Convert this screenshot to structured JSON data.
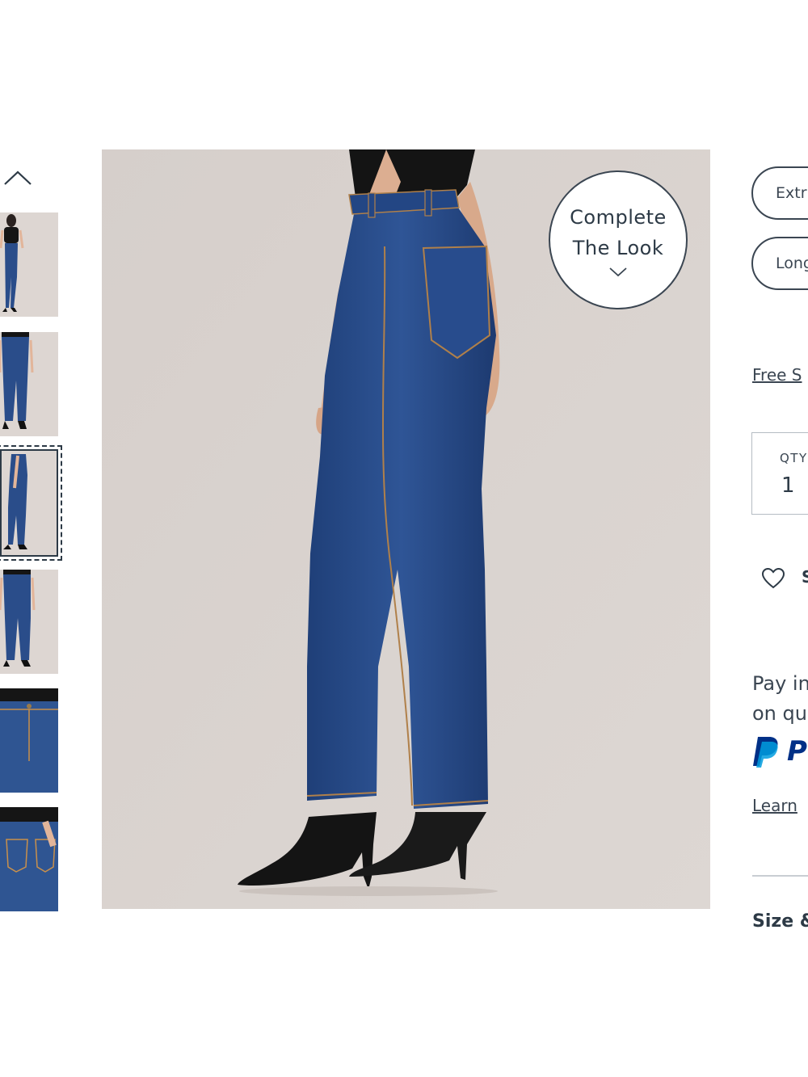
{
  "gallery": {
    "thumbnails": [
      {
        "label": "front view"
      },
      {
        "label": "front close view"
      },
      {
        "label": "side view",
        "active": true
      },
      {
        "label": "back view"
      },
      {
        "label": "front waist detail"
      },
      {
        "label": "back pocket detail"
      }
    ],
    "complete_look": {
      "line1": "Complete",
      "line2": "The Look"
    }
  },
  "product_panel": {
    "length_options": [
      "Extr",
      "Long"
    ],
    "shipping_link": "Free S",
    "quantity": {
      "label": "QTY",
      "value": "1"
    },
    "save_label": "S",
    "payment": {
      "line1": "Pay in",
      "line2": "on qu",
      "paypal_text": "P"
    },
    "learn_link": "Learn",
    "size_fit": "Size &"
  },
  "colors": {
    "denim": "#2a4d8a",
    "backdrop": "#d9d2cd",
    "text": "#2d3a46",
    "paypal_blue": "#003087",
    "paypal_light": "#009cde"
  }
}
